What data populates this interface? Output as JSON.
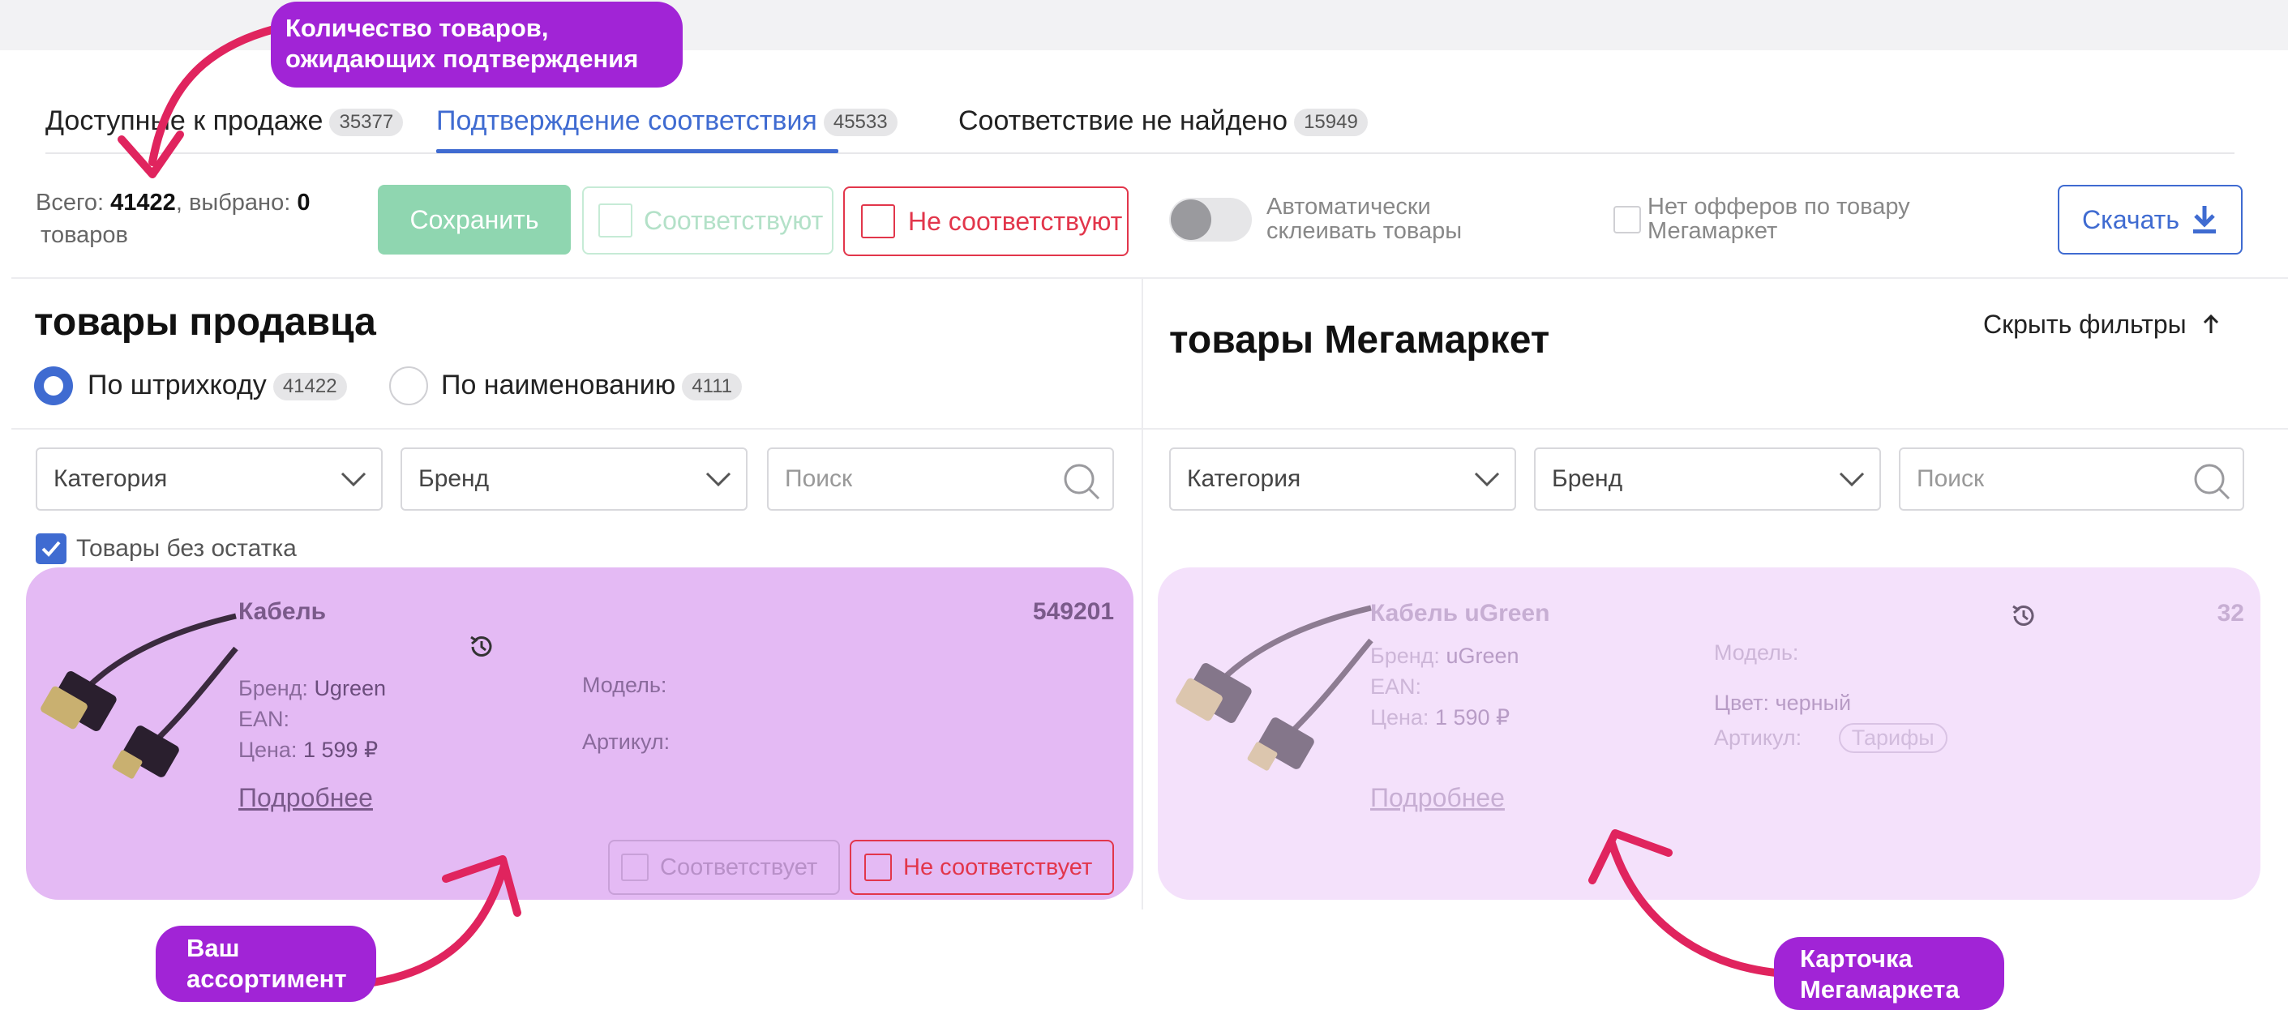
{
  "tabs": [
    {
      "label": "Доступные к продаже",
      "count": "35377"
    },
    {
      "label": "Подтверждение соответствия",
      "count": "45533"
    },
    {
      "label": "Соответствие не найдено",
      "count": "15949"
    }
  ],
  "toolbar": {
    "total_label": "Всего:",
    "total_value": "41422",
    "selected_label": ", выбрано:",
    "selected_value": "0",
    "items_word": "товаров",
    "save_label": "Сохранить",
    "match_label": "Соответствуют",
    "nomatch_label": "Не соответствуют",
    "auto_glue_label": "Автоматически склеивать товары",
    "no_offers_label": "Нет офферов по товару Мегамаркет",
    "download_label": "Скачать"
  },
  "seller": {
    "title": "товары продавца",
    "radio_barcode": "По штрихкоду",
    "radio_barcode_count": "41422",
    "radio_name": "По наименованию",
    "radio_name_count": "4111",
    "category_placeholder": "Категория",
    "brand_placeholder": "Бренд",
    "search_placeholder": "Поиск",
    "no_stock_label": "Товары без остатка"
  },
  "marketplace": {
    "title": "товары Мегамаркет",
    "hide_filters_label": "Скрыть фильтры",
    "category_placeholder": "Категория",
    "brand_placeholder": "Бренд",
    "search_placeholder": "Поиск"
  },
  "seller_card": {
    "name": "Кабель",
    "id": "549201",
    "brand_label": "Бренд:",
    "brand_value": "Ugreen",
    "ean_label": "EAN:",
    "price_label": "Цена:",
    "price_value": "1 599 ₽",
    "model_label": "Модель:",
    "article_label": "Артикул:",
    "details_link": "Подробнее",
    "match_label": "Соответствует",
    "nomatch_label": "Не соответствует"
  },
  "mm_card": {
    "name": "Кабель uGreen",
    "id": "32",
    "brand_label": "Бренд:",
    "brand_value": "uGreen",
    "ean_label": "EAN:",
    "price_label": "Цена:",
    "price_value": "1 590 ₽",
    "model_label": "Модель:",
    "color_label": "Цвет:",
    "color_value": "черный",
    "article_label": "Артикул:",
    "tariffs_label": "Тарифы",
    "details_link": "Подробнее"
  },
  "annotations": {
    "count_note": "Количество товаров, ожидающих подтверждения",
    "assortment_note": "Ваш ассортимент",
    "mm_card_note": "Карточка Мегамаркета"
  },
  "colors": {
    "accent_blue": "#3f6bd1",
    "save_green": "#8fd6b0",
    "error_red": "#e2364b",
    "seller_card_bg": "#e4baf4",
    "mm_card_bg": "#f4e1fb",
    "annotation_purple": "#a124d6",
    "arrow_pink": "#e0245e"
  }
}
